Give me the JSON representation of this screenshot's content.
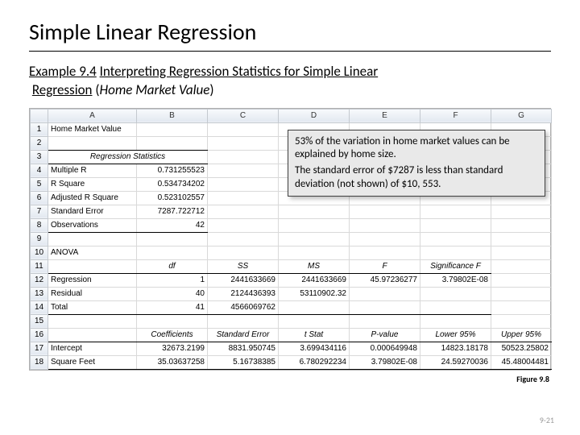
{
  "title": "Simple Linear Regression",
  "subtitle_u1": "Example 9.4",
  "subtitle_u2": "Interpreting Regression Statistics for Simple Linear",
  "subtitle_u3": "Regression",
  "subtitle_plain1": " (",
  "subtitle_italic": "Home Market Value",
  "subtitle_plain2": ")",
  "cols": {
    "A": "A",
    "B": "B",
    "C": "C",
    "D": "D",
    "E": "E",
    "F": "F",
    "G": "G"
  },
  "rows": {
    "r1": "1",
    "r2": "2",
    "r3": "3",
    "r4": "4",
    "r5": "5",
    "r6": "6",
    "r7": "7",
    "r8": "8",
    "r9": "9",
    "r10": "10",
    "r11": "11",
    "r12": "12",
    "r13": "13",
    "r14": "14",
    "r15": "15",
    "r16": "16",
    "r17": "17",
    "r18": "18"
  },
  "cells": {
    "a1": "Home Market Value",
    "a3": "Regression Statistics",
    "a4": "Multiple R",
    "b4": "0.731255523",
    "a5": "R Square",
    "b5": "0.534734202",
    "a6": "Adjusted R Square",
    "b6": "0.523102557",
    "a7": "Standard Error",
    "b7": "7287.722712",
    "a8": "Observations",
    "b8": "42",
    "a10": "ANOVA",
    "b11": "df",
    "c11": "SS",
    "d11": "MS",
    "e11": "F",
    "f11": "Significance F",
    "a12": "Regression",
    "b12": "1",
    "c12": "2441633669",
    "d12": "2441633669",
    "e12": "45.97236277",
    "f12": "3.79802E-08",
    "a13": "Residual",
    "b13": "40",
    "c13": "2124436393",
    "d13": "53110902.32",
    "a14": "Total",
    "b14": "41",
    "c14": "4566069762",
    "b16": "Coefficients",
    "c16": "Standard Error",
    "d16": "t Stat",
    "e16": "P-value",
    "f16": "Lower 95%",
    "g16": "Upper 95%",
    "a17": "Intercept",
    "b17": "32673.2199",
    "c17": "8831.950745",
    "d17": "3.699434116",
    "e17": "0.000649948",
    "f17": "14823.18178",
    "g17": "50523.25802",
    "a18": "Square Feet",
    "b18": "35.03637258",
    "c18": "5.16738385",
    "d18": "6.780292234",
    "e18": "3.79802E-08",
    "f18": "24.59270036",
    "g18": "45.48004481"
  },
  "callout": {
    "p1": "53% of the variation in home market values can be explained by home size.",
    "p2": "The standard error of $7287 is less than standard deviation (not shown) of $10, 553."
  },
  "figure_label": "Figure 9.8",
  "page_number": "9-21"
}
